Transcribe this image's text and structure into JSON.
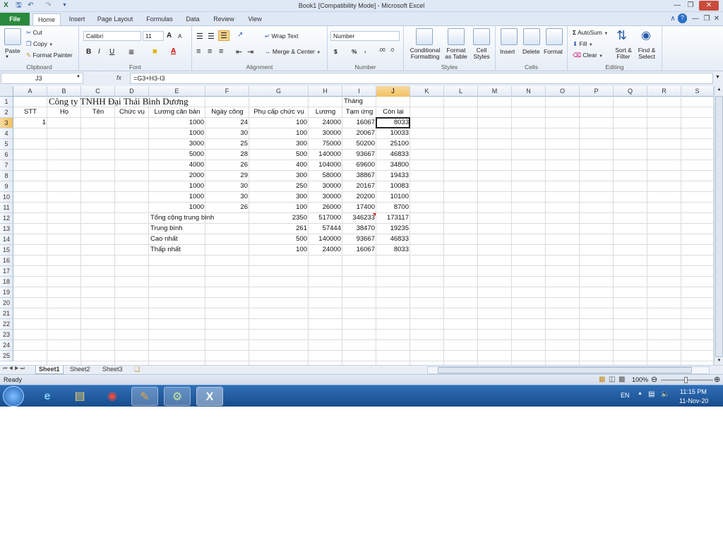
{
  "window": {
    "title": "Book1  [Compatibility Mode]  -  Microsoft Excel"
  },
  "ribbon_tabs": {
    "file": "File",
    "items": [
      "Home",
      "Insert",
      "Page Layout",
      "Formulas",
      "Data",
      "Review",
      "View"
    ]
  },
  "clipboard": {
    "paste": "Paste",
    "cut": "Cut",
    "copy": "Copy",
    "format_painter": "Format Painter",
    "label": "Clipboard"
  },
  "font": {
    "name": "Calibri",
    "size": "11",
    "bold": "B",
    "italic": "I",
    "underline": "U",
    "grow": "A",
    "shrink": "A",
    "label": "Font"
  },
  "alignment": {
    "wrap_text": "Wrap Text",
    "merge_center": "Merge & Center",
    "label": "Alignment"
  },
  "number": {
    "format": "Number",
    "currency": "$",
    "percent": "%",
    "comma": ",",
    "label": "Number"
  },
  "styles": {
    "conditional_formatting": "Conditional",
    "conditional_formatting2": "Formatting",
    "format_as_table": "Format",
    "format_as_table2": "as Table",
    "cell_styles": "Cell",
    "cell_styles2": "Styles",
    "label": "Styles"
  },
  "cells_group": {
    "insert": "Insert",
    "delete": "Delete",
    "format": "Format",
    "label": "Cells"
  },
  "editing": {
    "autosum": "AutoSum",
    "fill": "Fill",
    "clear": "Clear",
    "sort_filter": "Sort &",
    "sort_filter2": "Filter",
    "find_select": "Find &",
    "find_select2": "Select",
    "label": "Editing"
  },
  "formula_bar": {
    "name_box": "J3",
    "fx": "fx",
    "formula": "=G3+H3-I3"
  },
  "columns": [
    "A",
    "B",
    "C",
    "D",
    "E",
    "F",
    "G",
    "H",
    "I",
    "J",
    "K",
    "L",
    "M",
    "N",
    "O",
    "P",
    "Q",
    "R",
    "S"
  ],
  "rows": [
    "1",
    "2",
    "3",
    "4",
    "5",
    "6",
    "7",
    "8",
    "9",
    "10",
    "11",
    "12",
    "13",
    "14",
    "15",
    "16",
    "17",
    "18",
    "19",
    "20",
    "21",
    "22",
    "23",
    "24",
    "25"
  ],
  "cells": {
    "b1": "Công ty TNHH Đại Thái Bình Dương",
    "i1": "Tháng",
    "headers": {
      "a": "STT",
      "b": "Họ",
      "c": "Tên",
      "d": "Chức vụ",
      "e": "Lương căn bản",
      "f": "Ngày công",
      "g": "Phụ cấp chức vụ",
      "h": "Lương",
      "i": "Tạm ứng",
      "j": "Còn lại"
    },
    "a3": "1",
    "data": [
      {
        "e": "1000",
        "f": "24",
        "g": "100",
        "h": "24000",
        "i": "16067",
        "j": "8033"
      },
      {
        "e": "1000",
        "f": "30",
        "g": "100",
        "h": "30000",
        "i": "20067",
        "j": "10033"
      },
      {
        "e": "3000",
        "f": "25",
        "g": "300",
        "h": "75000",
        "i": "50200",
        "j": "25100"
      },
      {
        "e": "5000",
        "f": "28",
        "g": "500",
        "h": "140000",
        "i": "93667",
        "j": "46833"
      },
      {
        "e": "4000",
        "f": "26",
        "g": "400",
        "h": "104000",
        "i": "69600",
        "j": "34800"
      },
      {
        "e": "2000",
        "f": "29",
        "g": "300",
        "h": "58000",
        "i": "38867",
        "j": "19433"
      },
      {
        "e": "1000",
        "f": "30",
        "g": "250",
        "h": "30000",
        "i": "20167",
        "j": "10083"
      },
      {
        "e": "1000",
        "f": "30",
        "g": "300",
        "h": "30000",
        "i": "20200",
        "j": "10100"
      },
      {
        "e": "1000",
        "f": "26",
        "g": "100",
        "h": "26000",
        "i": "17400",
        "j": "8700"
      }
    ],
    "summary": [
      {
        "label": "Tổng cộng trung bình",
        "g": "2350",
        "h": "517000",
        "i": "346233",
        "j": "173117"
      },
      {
        "label": "Trung bình",
        "g": "261",
        "h": "57444",
        "i": "38470",
        "j": "19235"
      },
      {
        "label": "Cao nhất",
        "g": "500",
        "h": "140000",
        "i": "93667",
        "j": "46833"
      },
      {
        "label": "Thấp nhất",
        "g": "100",
        "h": "24000",
        "i": "16067",
        "j": "8033"
      }
    ]
  },
  "sheets": [
    "Sheet1",
    "Sheet2",
    "Sheet3"
  ],
  "status": {
    "ready": "Ready",
    "zoom": "100%"
  },
  "taskbar": {
    "lang": "EN",
    "time": "11:15 PM",
    "date": "11-Nov-20"
  }
}
